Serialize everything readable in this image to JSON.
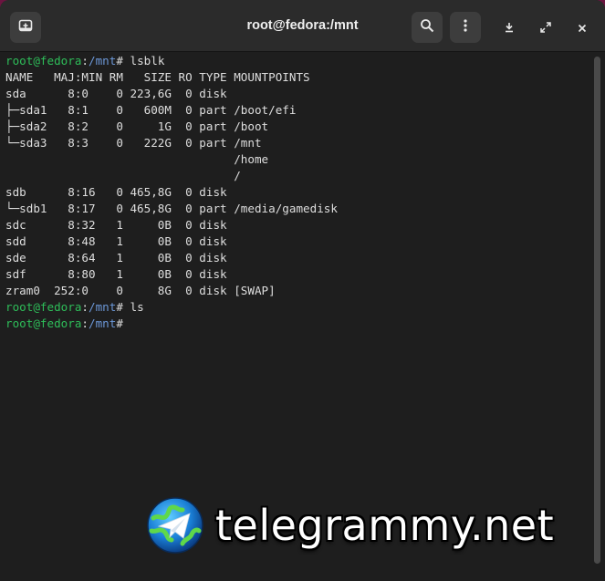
{
  "window": {
    "title": "root@fedora:/mnt"
  },
  "icons": {
    "new_tab": "new-tab-icon",
    "search": "search-icon",
    "menu": "kebab-menu-icon",
    "minimize": "minimize-icon",
    "maximize": "maximize-icon",
    "close": "close-icon"
  },
  "colors": {
    "prompt_user": "#2ebd59",
    "prompt_path": "#6c98d8",
    "terminal_bg": "#1e1e1e",
    "terminal_fg": "#dedede"
  },
  "terminal": {
    "lines": [
      {
        "user": "root@fedora",
        "sep": ":",
        "path": "/mnt",
        "cmd": "# lsblk"
      },
      {
        "text": "NAME   MAJ:MIN RM   SIZE RO TYPE MOUNTPOINTS"
      },
      {
        "text": "sda      8:0    0 223,6G  0 disk "
      },
      {
        "text": "├─sda1   8:1    0   600M  0 part /boot/efi"
      },
      {
        "text": "├─sda2   8:2    0     1G  0 part /boot"
      },
      {
        "text": "└─sda3   8:3    0   222G  0 part /mnt"
      },
      {
        "text": "                                 /home"
      },
      {
        "text": "                                 /"
      },
      {
        "text": "sdb      8:16   0 465,8G  0 disk "
      },
      {
        "text": "└─sdb1   8:17   0 465,8G  0 part /media/gamedisk"
      },
      {
        "text": "sdc      8:32   1     0B  0 disk "
      },
      {
        "text": "sdd      8:48   1     0B  0 disk "
      },
      {
        "text": "sde      8:64   1     0B  0 disk "
      },
      {
        "text": "sdf      8:80   1     0B  0 disk "
      },
      {
        "text": "zram0  252:0    0     8G  0 disk [SWAP]"
      },
      {
        "user": "root@fedora",
        "sep": ":",
        "path": "/mnt",
        "cmd": "# ls"
      },
      {
        "user": "root@fedora",
        "sep": ":",
        "path": "/mnt",
        "cmd": "#"
      }
    ]
  },
  "watermark": {
    "text": "telegrammy.net"
  }
}
